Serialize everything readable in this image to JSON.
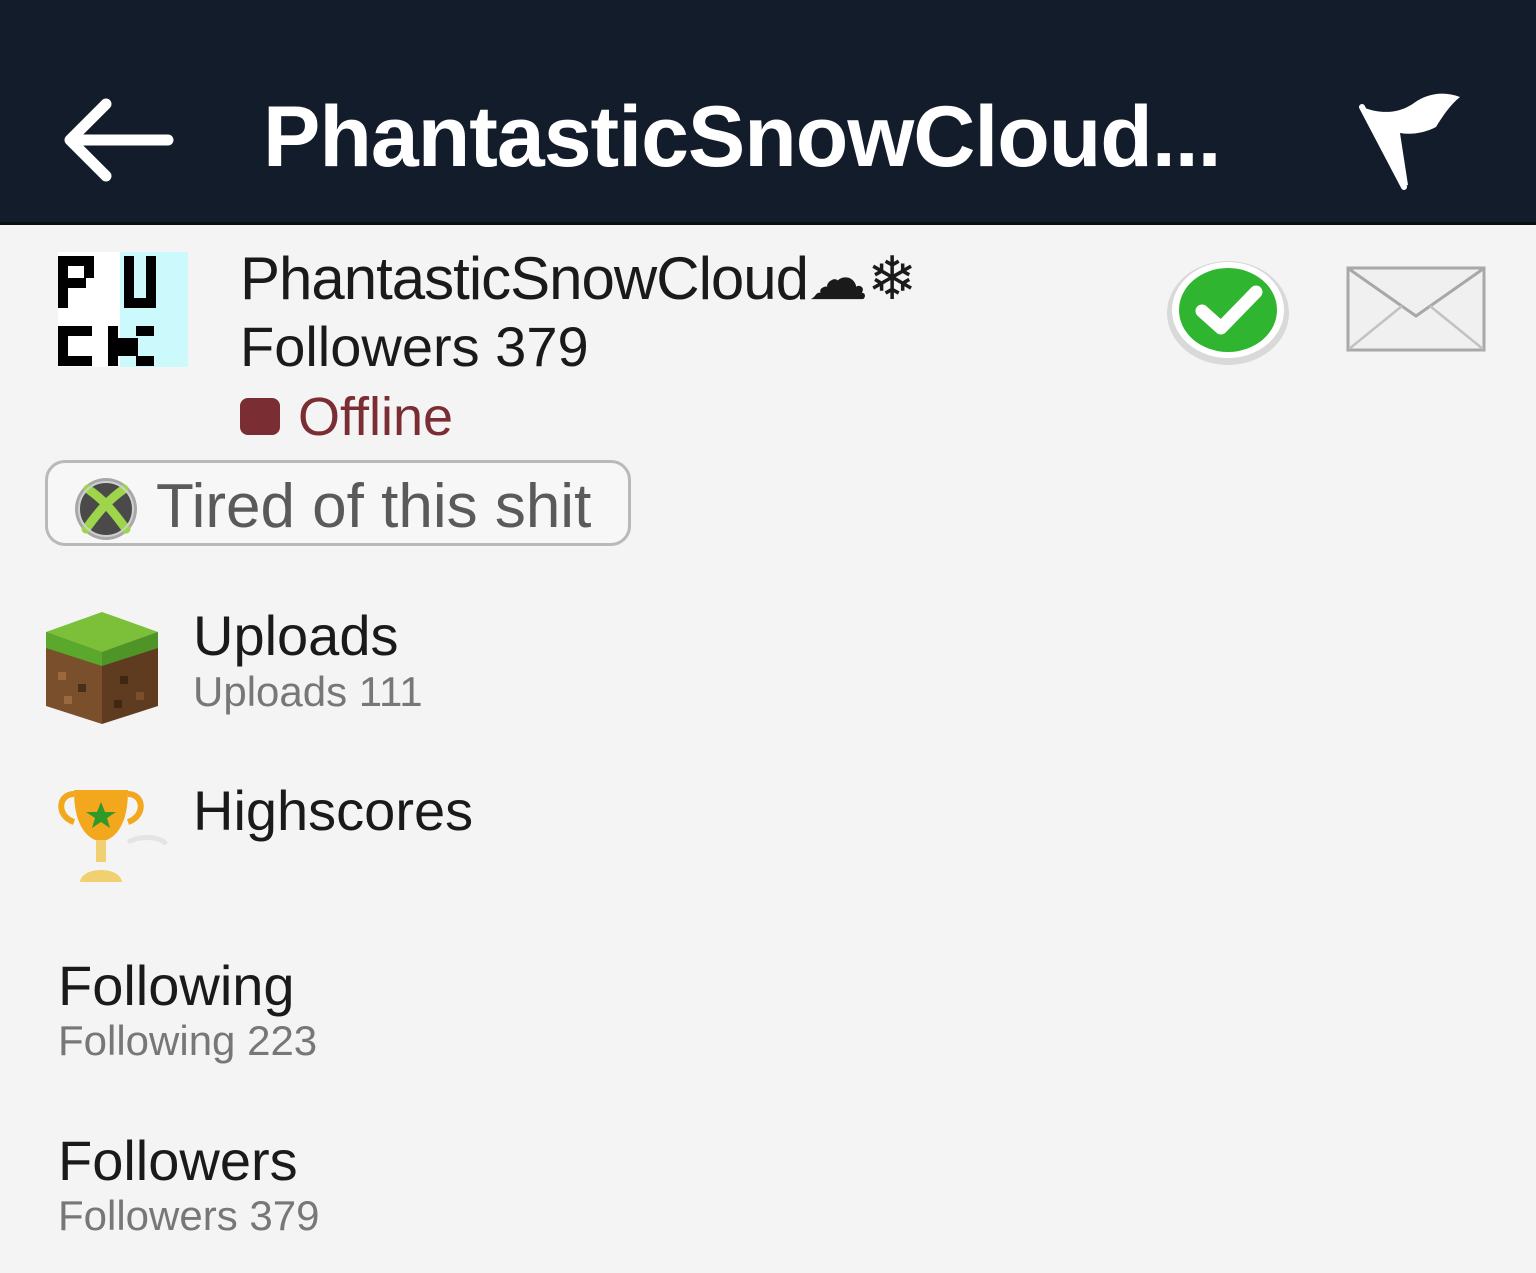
{
  "header": {
    "title": "PhantasticSnowCloud...",
    "back_icon": "arrow-left-icon",
    "flag_icon": "flag-icon"
  },
  "profile": {
    "username": "PhantasticSnowCloud☁❄",
    "followers_line": "Followers 379",
    "status": "Offline",
    "status_color": "#7a2d33",
    "avatar_text": "FUCK"
  },
  "status_message": {
    "text": "Tired of this shit",
    "icon": "xbox-icon"
  },
  "menu": {
    "uploads": {
      "title": "Uploads",
      "subtitle": "Uploads 111"
    },
    "highscores": {
      "title": "Highscores"
    },
    "following": {
      "title": "Following",
      "subtitle": "Following 223"
    },
    "followers": {
      "title": "Followers",
      "subtitle": "Followers 379"
    }
  },
  "colors": {
    "header_bg": "#131c2a",
    "page_bg": "#f4f4f4",
    "follow_green": "#2fb52f"
  }
}
